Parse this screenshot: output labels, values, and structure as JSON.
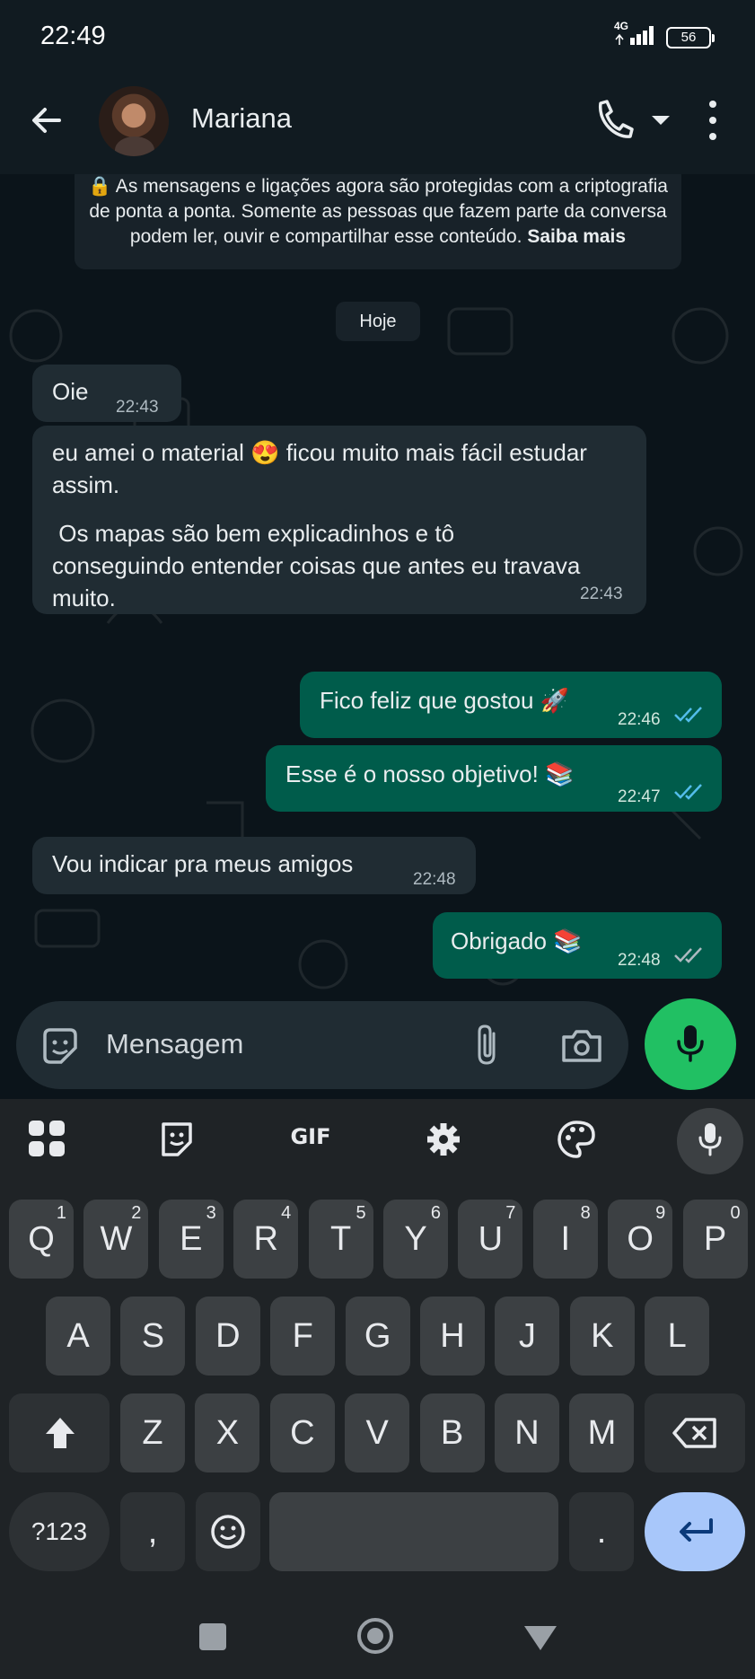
{
  "status_bar": {
    "time": "22:49",
    "network": "4G",
    "battery": "56"
  },
  "header": {
    "contact_name": "Mariana"
  },
  "chat": {
    "encryption_notice": "🔒 As mensagens e ligações agora são protegidas com a criptografia de ponta a ponta. Somente as pessoas que fazem parte da conversa podem ler, ouvir e compartilhar esse conteúdo.",
    "encryption_link": "Saiba mais",
    "date_chip": "Hoje",
    "messages": [
      {
        "direction": "in",
        "text": "Oie",
        "time": "22:43"
      },
      {
        "direction": "in",
        "text": "eu amei o material 😍 ficou muito mais fácil estudar assim.",
        "text2": " Os mapas são bem explicadinhos e tô conseguindo entender coisas que antes eu travava muito.",
        "time": "22:43"
      },
      {
        "direction": "out",
        "text": "Fico feliz que gostou 🚀",
        "time": "22:46",
        "read": true
      },
      {
        "direction": "out",
        "text": "Esse é o nosso objetivo! 📚",
        "time": "22:47",
        "read": true
      },
      {
        "direction": "in",
        "text": "Vou indicar pra meus amigos",
        "time": "22:48"
      },
      {
        "direction": "out",
        "text": "Obrigado 📚",
        "time": "22:48",
        "read": false
      }
    ]
  },
  "composer": {
    "placeholder": "Mensagem"
  },
  "keyboard": {
    "toolbar": {
      "gif_label": "GIF"
    },
    "row1": [
      "Q",
      "W",
      "E",
      "R",
      "T",
      "Y",
      "U",
      "I",
      "O",
      "P"
    ],
    "row1_nums": [
      "1",
      "2",
      "3",
      "4",
      "5",
      "6",
      "7",
      "8",
      "9",
      "0"
    ],
    "row2": [
      "A",
      "S",
      "D",
      "F",
      "G",
      "H",
      "J",
      "K",
      "L"
    ],
    "row3": [
      "Z",
      "X",
      "C",
      "V",
      "B",
      "N",
      "M"
    ],
    "symbols_label": "?123",
    "comma_label": ",",
    "period_label": "."
  },
  "colors": {
    "accent": "#21c063",
    "outgoing": "#005c4b",
    "incoming": "#202c33",
    "read_ticks": "#53bdeb"
  }
}
